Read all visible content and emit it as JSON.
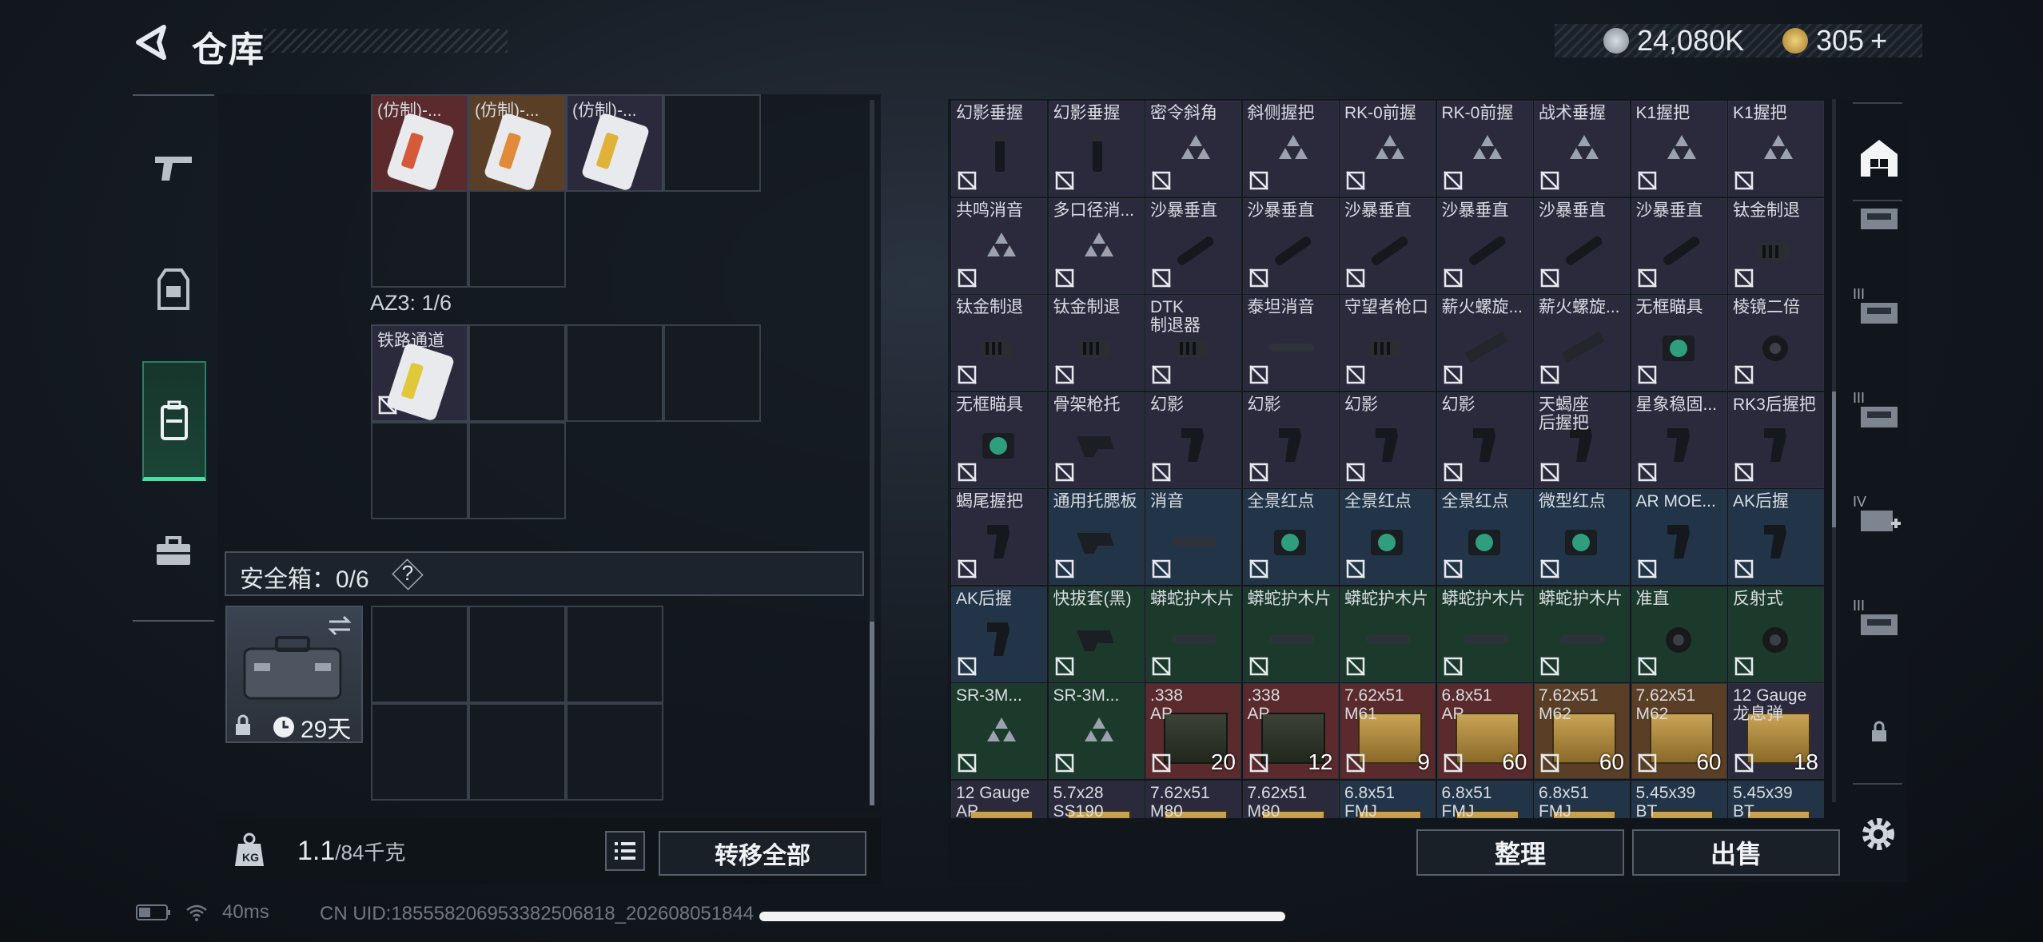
{
  "header": {
    "title": "仓库"
  },
  "currency": {
    "coins": "24,080K",
    "tickets": "305",
    "plus": "+"
  },
  "colors": {
    "accent": "#46e0a6",
    "red": "#5a2a2c",
    "orange": "#5a3f26",
    "blue": "#223548",
    "green": "#1c3a2c",
    "purple": "#2b2a3d"
  },
  "left_nav": [
    {
      "icon": "pistol-icon"
    },
    {
      "icon": "vest-icon"
    },
    {
      "icon": "backpack-icon"
    },
    {
      "icon": "toolbox-icon"
    }
  ],
  "container_top": {
    "items": [
      {
        "label": "(仿制)-...",
        "bg": "red",
        "stripe": "#d65a3a"
      },
      {
        "label": "(仿制)-...",
        "bg": "orange",
        "stripe": "#e08a3a"
      },
      {
        "label": "(仿制)-...",
        "bg": "purple",
        "stripe": "#e0b23a"
      }
    ]
  },
  "az3": {
    "label": "AZ3: 1/6",
    "item_label": "铁路通道"
  },
  "safe": {
    "label": "安全箱：0/6",
    "help": "?",
    "days": "29天"
  },
  "weight": {
    "current": "1.1",
    "capacity": "/84千克"
  },
  "buttons": {
    "transfer_all": "转移全部",
    "sort": "整理",
    "sell": "出售"
  },
  "stash": [
    [
      {
        "name": "幻影垂握",
        "bg": "purple",
        "g": "grip"
      },
      {
        "name": "幻影垂握",
        "bg": "purple",
        "g": "grip"
      },
      {
        "name": "密令斜角",
        "bg": "purple",
        "g": "tri"
      },
      {
        "name": "斜侧握把",
        "bg": "purple",
        "g": "tri"
      },
      {
        "name": "RK-0前握",
        "bg": "purple",
        "g": "tri"
      },
      {
        "name": "RK-0前握",
        "bg": "purple",
        "g": "tri"
      },
      {
        "name": "战术垂握",
        "bg": "purple",
        "g": "tri"
      },
      {
        "name": "K1握把",
        "bg": "purple",
        "g": "tri"
      },
      {
        "name": "K1握把",
        "bg": "purple",
        "g": "tri"
      }
    ],
    [
      {
        "name": "共鸣消音",
        "bg": "purple",
        "g": "tri"
      },
      {
        "name": "多口径消...",
        "bg": "purple",
        "g": "tri"
      },
      {
        "name": "沙暴垂直",
        "bg": "purple",
        "g": "stick"
      },
      {
        "name": "沙暴垂直",
        "bg": "purple",
        "g": "stick"
      },
      {
        "name": "沙暴垂直",
        "bg": "purple",
        "g": "stick"
      },
      {
        "name": "沙暴垂直",
        "bg": "purple",
        "g": "stick"
      },
      {
        "name": "沙暴垂直",
        "bg": "purple",
        "g": "stick"
      },
      {
        "name": "沙暴垂直",
        "bg": "purple",
        "g": "stick"
      },
      {
        "name": "钛金制退",
        "bg": "purple",
        "g": "brake"
      }
    ],
    [
      {
        "name": "钛金制退",
        "bg": "purple",
        "g": "brake"
      },
      {
        "name": "钛金制退",
        "bg": "purple",
        "g": "brake"
      },
      {
        "name": "DTK\n制退器",
        "bg": "purple",
        "g": "brake"
      },
      {
        "name": "泰坦消音",
        "bg": "purple",
        "g": "tube"
      },
      {
        "name": "守望者枪口",
        "bg": "purple",
        "g": "brake"
      },
      {
        "name": "薪火螺旋...",
        "bg": "purple",
        "g": "rail"
      },
      {
        "name": "薪火螺旋...",
        "bg": "purple",
        "g": "rail"
      },
      {
        "name": "无框瞄具",
        "bg": "purple",
        "g": "sight"
      },
      {
        "name": "棱镜二倍",
        "bg": "purple",
        "g": "scope"
      }
    ],
    [
      {
        "name": "无框瞄具",
        "bg": "purple",
        "g": "sight"
      },
      {
        "name": "骨架枪托",
        "bg": "purple",
        "g": "stock"
      },
      {
        "name": "幻影",
        "bg": "purple",
        "g": "pgrip"
      },
      {
        "name": "幻影",
        "bg": "purple",
        "g": "pgrip"
      },
      {
        "name": "幻影",
        "bg": "purple",
        "g": "pgrip"
      },
      {
        "name": "幻影",
        "bg": "purple",
        "g": "pgrip"
      },
      {
        "name": "天蝎座\n后握把",
        "bg": "purple",
        "g": "pgrip"
      },
      {
        "name": "星象稳固...",
        "bg": "purple",
        "g": "pgrip"
      },
      {
        "name": "RK3后握把",
        "bg": "purple",
        "g": "pgrip"
      }
    ],
    [
      {
        "name": "蝎尾握把",
        "bg": "purple",
        "g": "pgrip"
      },
      {
        "name": "通用托腮板",
        "bg": "blue",
        "g": "stock"
      },
      {
        "name": "消音",
        "bg": "blue",
        "g": "tube"
      },
      {
        "name": "全景红点",
        "bg": "blue",
        "g": "sight"
      },
      {
        "name": "全景红点",
        "bg": "blue",
        "g": "sight"
      },
      {
        "name": "全景红点",
        "bg": "blue",
        "g": "sight"
      },
      {
        "name": "微型红点",
        "bg": "blue",
        "g": "sight"
      },
      {
        "name": "AR MOE...",
        "bg": "blue",
        "g": "pgrip"
      },
      {
        "name": "AK后握",
        "bg": "blue",
        "g": "pgrip"
      }
    ],
    [
      {
        "name": "AK后握",
        "bg": "blue",
        "g": "pgrip"
      },
      {
        "name": "快拔套(黑)",
        "bg": "green",
        "g": "stock"
      },
      {
        "name": "蟒蛇护木片",
        "bg": "green",
        "g": "tube"
      },
      {
        "name": "蟒蛇护木片",
        "bg": "green",
        "g": "tube"
      },
      {
        "name": "蟒蛇护木片",
        "bg": "green",
        "g": "tube"
      },
      {
        "name": "蟒蛇护木片",
        "bg": "green",
        "g": "tube"
      },
      {
        "name": "蟒蛇护木片",
        "bg": "green",
        "g": "tube"
      },
      {
        "name": "准直",
        "bg": "green",
        "g": "scope"
      },
      {
        "name": "反射式",
        "bg": "green",
        "g": "scope"
      }
    ],
    [
      {
        "name": "SR-3M...",
        "bg": "green",
        "g": "tri"
      },
      {
        "name": "SR-3M...",
        "bg": "green",
        "g": "tri"
      },
      {
        "name": ".338\nAP",
        "bg": "red",
        "g": "ammo-green",
        "count": "20"
      },
      {
        "name": ".338\nAP",
        "bg": "red",
        "g": "ammo-green",
        "count": "12"
      },
      {
        "name": "7.62x51\nM61",
        "bg": "red",
        "g": "ammo",
        "count": "9"
      },
      {
        "name": "6.8x51\nAP",
        "bg": "red",
        "g": "ammo",
        "count": "60"
      },
      {
        "name": "7.62x51\nM62",
        "bg": "orange",
        "g": "ammo",
        "count": "60"
      },
      {
        "name": "7.62x51\nM62",
        "bg": "orange",
        "g": "ammo",
        "count": "60"
      },
      {
        "name": "12 Gauge\n龙息弹",
        "bg": "purple",
        "g": "ammo",
        "count": "18"
      }
    ],
    [
      {
        "name": "12 Gauge\nAP",
        "bg": "purple",
        "g": "ammo"
      },
      {
        "name": "5.7x28\nSS190",
        "bg": "purple",
        "g": "ammo"
      },
      {
        "name": "7.62x51\nM80",
        "bg": "purple",
        "g": "ammo"
      },
      {
        "name": "7.62x51\nM80",
        "bg": "purple",
        "g": "ammo"
      },
      {
        "name": "6.8x51\nFMJ",
        "bg": "blue",
        "g": "ammo"
      },
      {
        "name": "6.8x51\nFMJ",
        "bg": "blue",
        "g": "ammo"
      },
      {
        "name": "6.8x51\nFMJ",
        "bg": "blue",
        "g": "ammo"
      },
      {
        "name": "5.45x39\nBT",
        "bg": "blue",
        "g": "ammo"
      },
      {
        "name": "5.45x39\nBT",
        "bg": "blue",
        "g": "ammo"
      }
    ]
  ],
  "right_nav": [
    {
      "icon": "stash-icon",
      "tier": ""
    },
    {
      "icon": "crate-icon",
      "tier": ""
    },
    {
      "icon": "crate-icon",
      "tier": "III"
    },
    {
      "icon": "crate-icon",
      "tier": "III"
    },
    {
      "icon": "medkit-crate-icon",
      "tier": "IV"
    },
    {
      "icon": "crate-icon",
      "tier": "III"
    },
    {
      "icon": "lock-icon",
      "tier": ""
    }
  ],
  "status": {
    "ping": "40ms",
    "uid": "CN UID:185558206953382506818_202608051844"
  }
}
